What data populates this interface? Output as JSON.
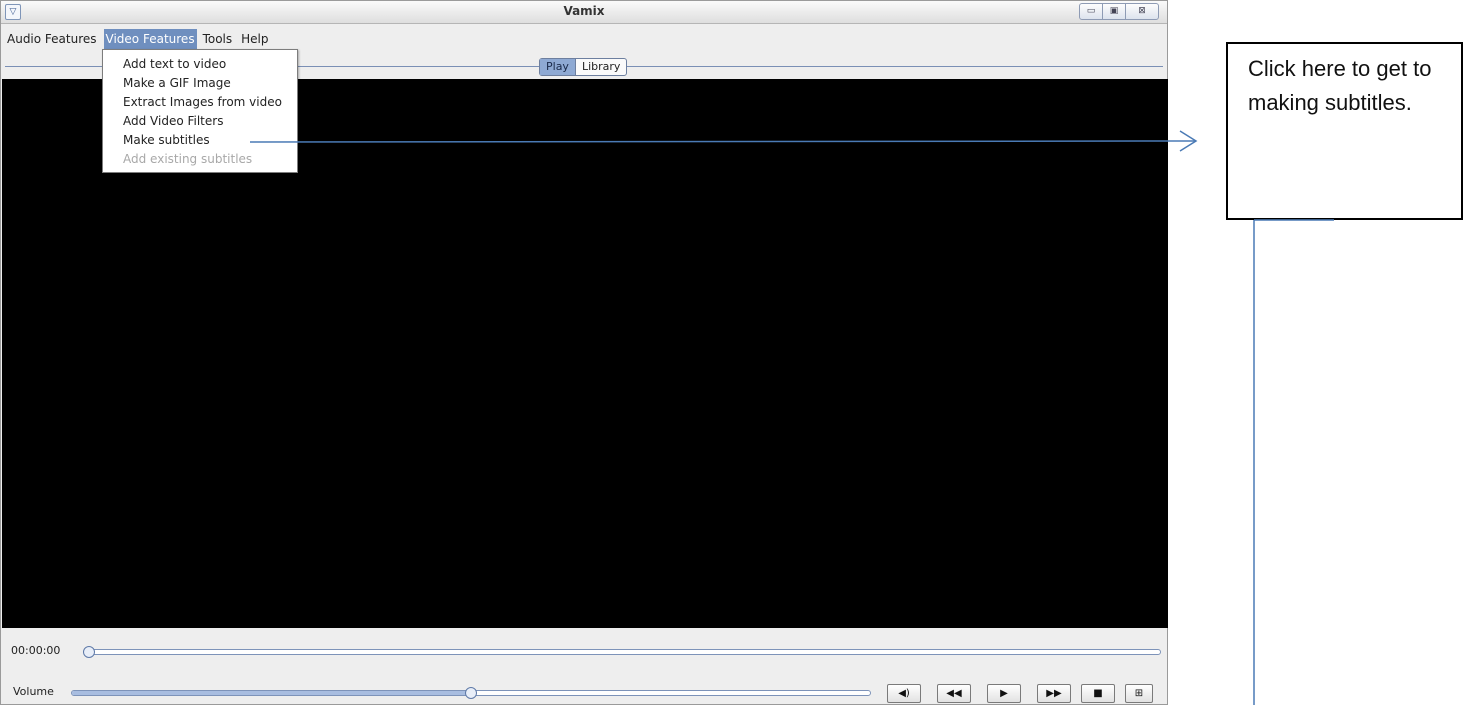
{
  "window": {
    "title": "Vamix",
    "sys_menu_glyph": "▽",
    "buttons": {
      "minimize": "▭",
      "maximize": "▣",
      "close": "⊠"
    }
  },
  "menubar": {
    "items": [
      "Audio Features",
      "Video Features",
      "Tools",
      "Help"
    ],
    "active": "Video Features"
  },
  "video_features_menu": {
    "items": [
      {
        "label": "Add text to video",
        "enabled": true
      },
      {
        "label": "Make a GIF Image",
        "enabled": true
      },
      {
        "label": "Extract Images from video",
        "enabled": true
      },
      {
        "label": "Add Video Filters",
        "enabled": true
      },
      {
        "label": "Make subtitles",
        "enabled": true
      },
      {
        "label": "Add existing subtitles",
        "enabled": false
      }
    ]
  },
  "tabs": {
    "items": [
      "Play",
      "Library"
    ],
    "selected": "Play"
  },
  "player": {
    "timecode": "00:00:00",
    "progress_fraction": 0.0,
    "volume_label": "Volume",
    "volume_fraction": 0.5,
    "controls": {
      "mute": "◀)",
      "rewind": "◀◀",
      "play": "▶",
      "fast_forward": "▶▶",
      "stop": "■",
      "fullscreen": "⊞"
    }
  },
  "annotation": {
    "text": "Click here to get to making subtitles.",
    "color": "#4a7ab5"
  },
  "colors": {
    "accent": "#6f8fbf",
    "video_bg": "#000000",
    "annotation_line": "#4a7ab5"
  }
}
